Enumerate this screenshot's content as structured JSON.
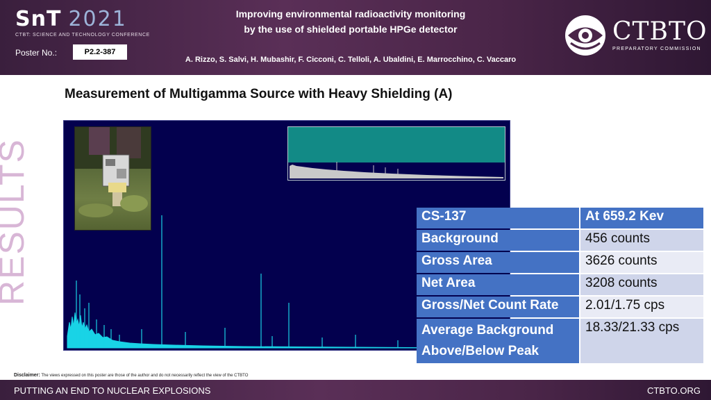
{
  "header": {
    "snt_logo": {
      "brand": "SnT",
      "year": "2021",
      "subtitle": "CTBT: SCIENCE AND TECHNOLOGY CONFERENCE"
    },
    "poster_no_label": "Poster No.:",
    "poster_no": "P2.2-387",
    "title_line1": "Improving environmental radioactivity monitoring",
    "title_line2": "by the use of shielded portable HPGe detector",
    "authors": "A. Rizzo, S. Salvi, H. Mubashir, F. Cicconi, C. Telloli, A. Ubaldini, E. Marrocchino, C. Vaccaro",
    "ctbto_logo": {
      "name": "CTBTO",
      "subtitle": "PREPARATORY COMMISSION"
    }
  },
  "side_label": "RESULTS",
  "section_heading": "Measurement of Multigamma Source with Heavy Shielding (A)",
  "table": {
    "header": {
      "label": "CS-137",
      "value": "At 659.2 Kev"
    },
    "rows": [
      {
        "label": "Background",
        "value": "456 counts"
      },
      {
        "label": "Gross Area",
        "value": "3626 counts"
      },
      {
        "label": "Net Area",
        "value": "3208 counts"
      },
      {
        "label": "Gross/Net Count Rate",
        "value": "2.01/1.75 cps"
      },
      {
        "label": "Average Background Above/Below Peak",
        "value": "18.33/21.33 cps"
      }
    ]
  },
  "disclaimer": {
    "label": "Disclaimer:",
    "text": "The views expressed on this poster are those of the author and do not necessarily reflect the view of the CTBTO"
  },
  "footer": {
    "left": "PUTTING AN END TO NUCLEAR EXPLOSIONS",
    "right": "CTBTO.ORG"
  },
  "colors": {
    "header_bg": "#4a2548",
    "spectrum_bg": "#03004e",
    "spectrum_trace": "#19d3e6",
    "table_header": "#4472c4",
    "table_row_dark": "#cfd5ea",
    "table_row_light": "#e9ebf5",
    "side_label": "#d8b6d6"
  }
}
